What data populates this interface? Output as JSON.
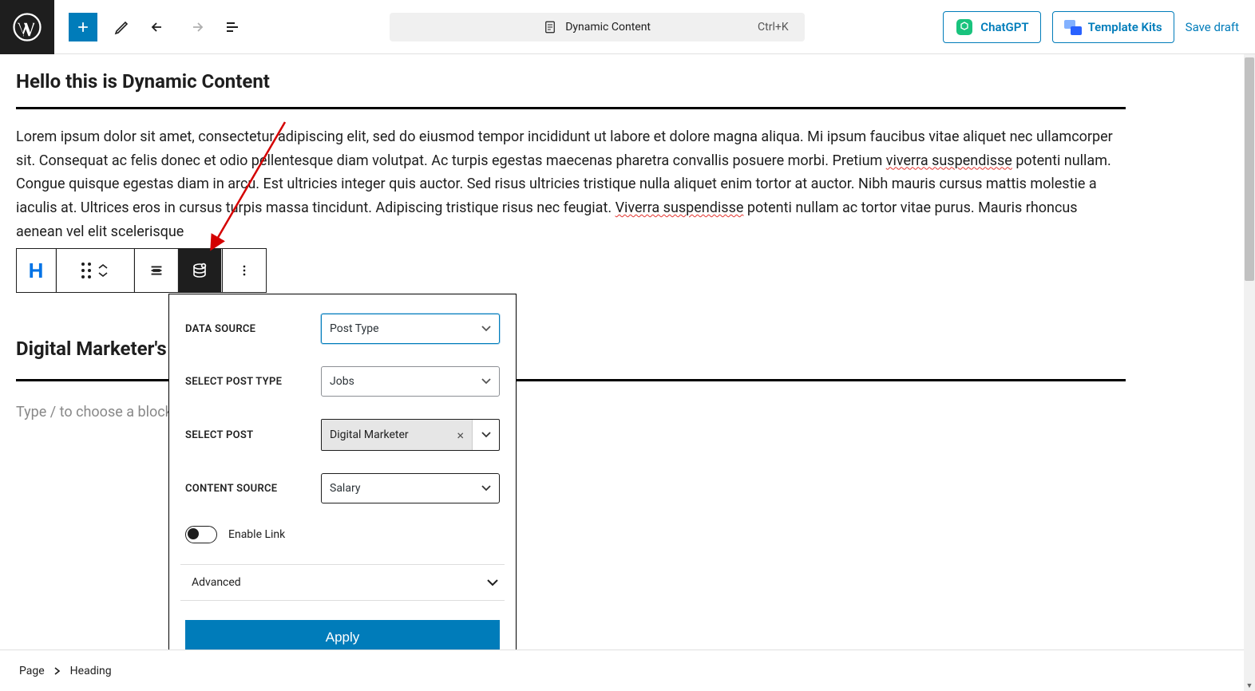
{
  "topbar": {
    "doc_title": "Dynamic Content",
    "kbd_hint": "Ctrl+K",
    "chatgpt_label": "ChatGPT",
    "template_kits_label": "Template Kits",
    "save_label": "Save draft"
  },
  "content": {
    "heading": "Hello this is Dynamic Content",
    "paragraph_parts": [
      "Lorem ipsum dolor sit amet, consectetur adipiscing elit, sed do eiusmod tempor incididunt ut labore et dolore magna aliqua. Mi ipsum faucibus vitae aliquet nec ullamcorper sit. Consequat ac felis donec et odio pellentesque diam volutpat. Ac turpis egestas maecenas pharetra convallis posuere morbi. Pretium ",
      "viverra suspendisse",
      " potenti nullam. Congue quisque egestas diam in arcu. Est ultricies integer quis auctor. Sed risus ultricies tristique nulla aliquet enim tortor at auctor. Nibh mauris cursus mattis molestie a iaculis at. Ultrices eros in cursus turpis massa tincidunt. Adipiscing tristique risus nec feugiat. ",
      "Viverra suspendisse",
      " potenti nullam ac tortor vitae purus. Mauris rhoncus aenean vel elit scelerisque"
    ],
    "subheading": "Digital Marketer's",
    "placeholder": "Type / to choose a block"
  },
  "popover": {
    "labels": {
      "data_source": "DATA SOURCE",
      "select_post_type": "SELECT POST TYPE",
      "select_post": "SELECT POST",
      "content_source": "CONTENT SOURCE",
      "enable_link": "Enable Link",
      "advanced": "Advanced",
      "apply": "Apply"
    },
    "values": {
      "data_source": "Post Type",
      "select_post_type": "Jobs",
      "select_post": "Digital Marketer",
      "content_source": "Salary"
    }
  },
  "footer": {
    "crumb1": "Page",
    "crumb2": "Heading"
  }
}
